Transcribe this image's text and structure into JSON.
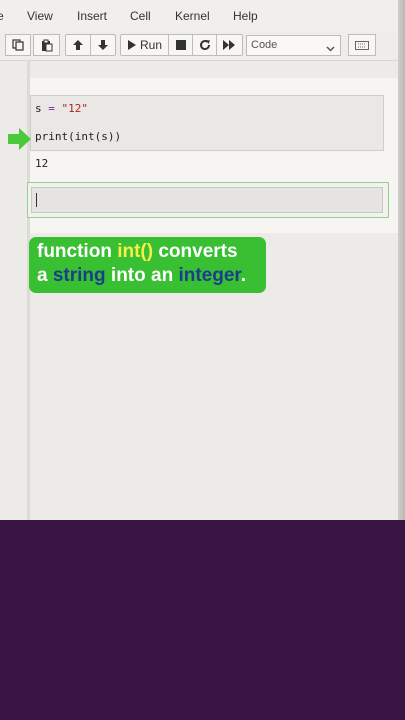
{
  "menubar": {
    "edge": "e",
    "view": "View",
    "insert": "Insert",
    "cell": "Cell",
    "kernel": "Kernel",
    "help": "Help"
  },
  "toolbar": {
    "run_label": "Run",
    "cell_type": "Code"
  },
  "cell": {
    "line1_var": "s ",
    "line1_op": "=",
    "line1_sp": " ",
    "line1_str": "\"12\"",
    "line2": "print(int(s))",
    "output": "12"
  },
  "caption": {
    "w1": "function ",
    "w2": "int()",
    "w3": " converts",
    "w4": "a ",
    "w5": "string",
    "w6": " into an ",
    "w7": "integer",
    "w8": "."
  },
  "colors": {
    "caption_bg": "#38c032",
    "highlight_yellow": "#f6ef4a",
    "highlight_blue": "#1c3d8c",
    "arrow": "#4cc93a",
    "background": "#3b1446"
  },
  "icons": [
    "copy-icon",
    "paste-icon",
    "arrow-up-icon",
    "arrow-down-icon",
    "play-icon",
    "stop-icon",
    "restart-icon",
    "fast-forward-icon",
    "chevron-down-icon",
    "keyboard-icon",
    "pointer-arrow-icon"
  ]
}
